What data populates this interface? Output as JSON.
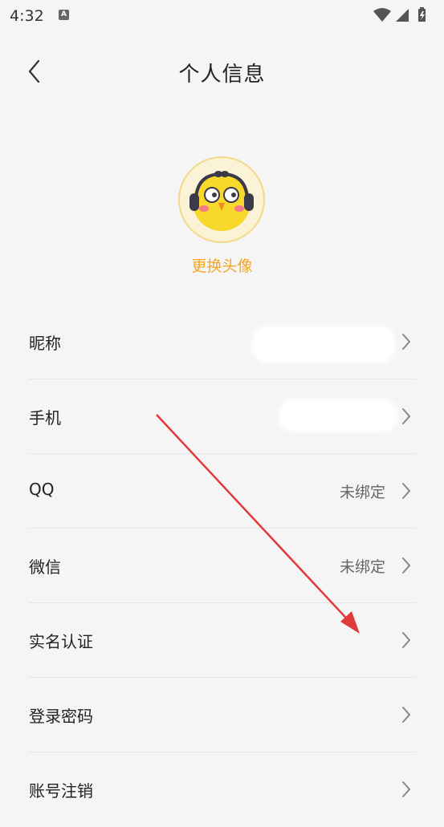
{
  "status_bar": {
    "time": "4:32",
    "notification_icon": "a-icon",
    "icons": [
      "wifi-icon",
      "signal-icon",
      "battery-icon"
    ]
  },
  "header": {
    "back_icon": "chevron-left-icon",
    "title": "个人信息"
  },
  "avatar": {
    "change_label": "更换头像",
    "accent_color": "#f5a623"
  },
  "rows": [
    {
      "label": "昵称",
      "value": ""
    },
    {
      "label": "手机",
      "value": ""
    },
    {
      "label": "QQ",
      "value": "未绑定"
    },
    {
      "label": "微信",
      "value": "未绑定"
    },
    {
      "label": "实名认证",
      "value": ""
    },
    {
      "label": "登录密码",
      "value": ""
    },
    {
      "label": "账号注销",
      "value": ""
    }
  ],
  "annotation": {
    "arrow_color": "#e03a3a"
  }
}
